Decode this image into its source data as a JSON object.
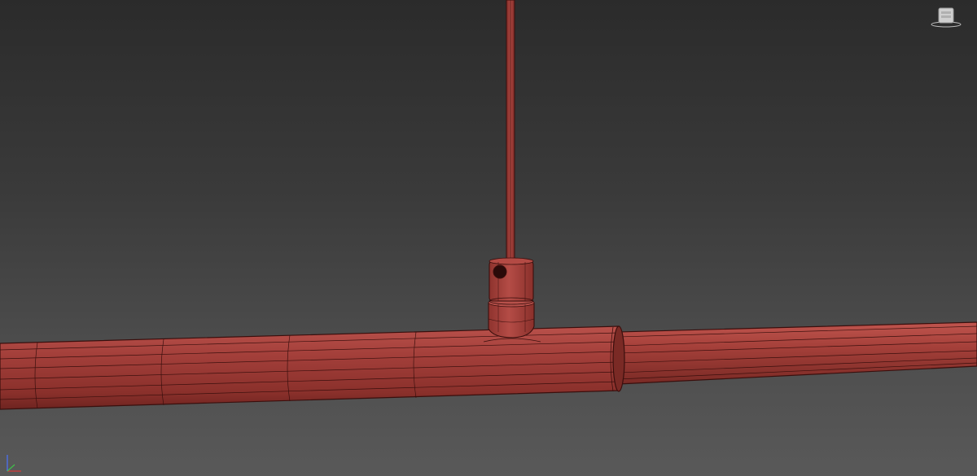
{
  "viewport": {
    "background_top": "#2b2b2b",
    "background_bottom": "#595959",
    "model_color": "#a03b36",
    "wire_color": "#3a0f0d"
  },
  "scene": {
    "objects": [
      "hanger-rod",
      "rod-clamp",
      "tee-fitting",
      "main-pipe-left",
      "main-pipe-right"
    ]
  },
  "icons": {
    "viewcube": "viewcube-icon",
    "axis": "axis-gizmo-icon"
  }
}
